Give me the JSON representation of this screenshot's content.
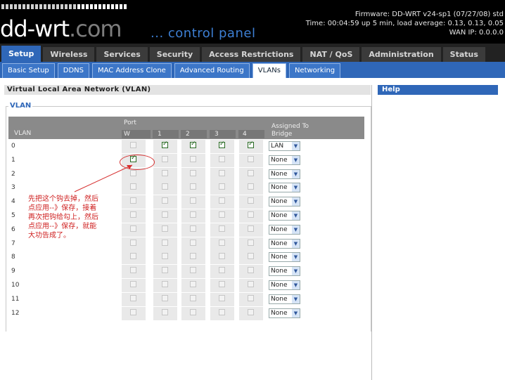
{
  "header": {
    "logo_main": "dd-wrt",
    "logo_suffix": ".com",
    "subtitle": "... control panel",
    "firmware": "Firmware: DD-WRT v24-sp1 (07/27/08) std",
    "time": "Time: 00:04:59 up 5 min, load average: 0.13, 0.13, 0.05",
    "wan_ip": "WAN IP: 0.0.0.0"
  },
  "main_nav": [
    "Setup",
    "Wireless",
    "Services",
    "Security",
    "Access Restrictions",
    "NAT / QoS",
    "Administration",
    "Status"
  ],
  "sub_nav": [
    "Basic Setup",
    "DDNS",
    "MAC Address Clone",
    "Advanced Routing",
    "VLANs",
    "Networking"
  ],
  "section_title": "Virtual Local Area Network (VLAN)",
  "help_title": "Help",
  "legend": "VLAN",
  "table_header": {
    "vlan": "VLAN",
    "port": "Port",
    "ports": [
      "W",
      "1",
      "2",
      "3",
      "4"
    ],
    "assigned_line1": "Assigned To",
    "assigned_line2": "Bridge"
  },
  "rows": [
    {
      "vlan": "0",
      "checks": [
        false,
        true,
        true,
        true,
        true
      ],
      "bridge": "LAN"
    },
    {
      "vlan": "1",
      "checks": [
        true,
        false,
        false,
        false,
        false
      ],
      "bridge": "None"
    },
    {
      "vlan": "2",
      "checks": [
        false,
        false,
        false,
        false,
        false
      ],
      "bridge": "None"
    },
    {
      "vlan": "3",
      "checks": [
        false,
        false,
        false,
        false,
        false
      ],
      "bridge": "None"
    },
    {
      "vlan": "4",
      "checks": [
        false,
        false,
        false,
        false,
        false
      ],
      "bridge": "None"
    },
    {
      "vlan": "5",
      "checks": [
        false,
        false,
        false,
        false,
        false
      ],
      "bridge": "None"
    },
    {
      "vlan": "6",
      "checks": [
        false,
        false,
        false,
        false,
        false
      ],
      "bridge": "None"
    },
    {
      "vlan": "7",
      "checks": [
        false,
        false,
        false,
        false,
        false
      ],
      "bridge": "None"
    },
    {
      "vlan": "8",
      "checks": [
        false,
        false,
        false,
        false,
        false
      ],
      "bridge": "None"
    },
    {
      "vlan": "9",
      "checks": [
        false,
        false,
        false,
        false,
        false
      ],
      "bridge": "None"
    },
    {
      "vlan": "10",
      "checks": [
        false,
        false,
        false,
        false,
        false
      ],
      "bridge": "None"
    },
    {
      "vlan": "11",
      "checks": [
        false,
        false,
        false,
        false,
        false
      ],
      "bridge": "None"
    },
    {
      "vlan": "12",
      "checks": [
        false,
        false,
        false,
        false,
        false
      ],
      "bridge": "None"
    }
  ],
  "annotation": "先把这个钩去掉，然后\n点应用--》保存，接着\n再次把钩给勾上，然后\n点应用--》保存，就能\n大功告成了。",
  "colors": {
    "accent": "#2f67b8",
    "annotation": "#cf2020"
  }
}
